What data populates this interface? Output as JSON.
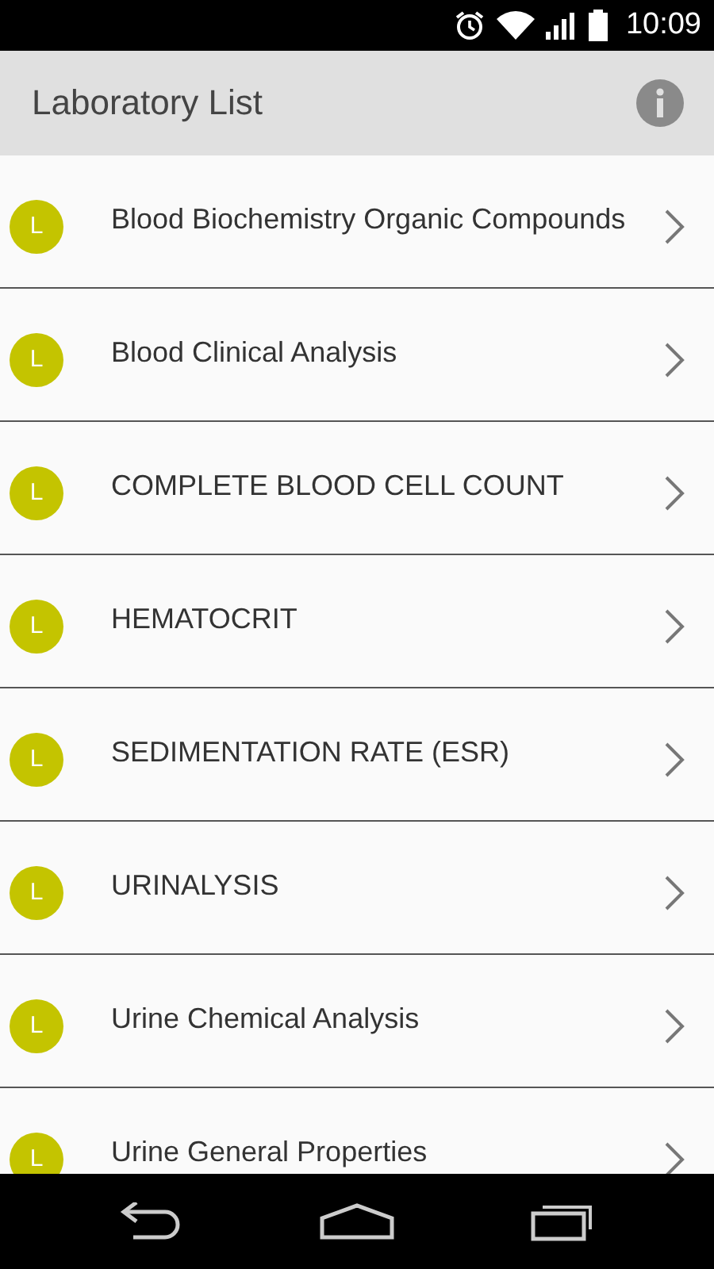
{
  "status_bar": {
    "time": "10:09"
  },
  "header": {
    "title": "Laboratory List"
  },
  "items": [
    {
      "badge": "L",
      "label": "Blood Biochemistry Organic Compounds"
    },
    {
      "badge": "L",
      "label": "Blood Clinical Analysis"
    },
    {
      "badge": "L",
      "label": "COMPLETE BLOOD CELL COUNT"
    },
    {
      "badge": "L",
      "label": "HEMATOCRIT"
    },
    {
      "badge": "L",
      "label": "SEDIMENTATION RATE (ESR)"
    },
    {
      "badge": "L",
      "label": "URINALYSIS"
    },
    {
      "badge": "L",
      "label": "Urine Chemical Analysis"
    },
    {
      "badge": "L",
      "label": "Urine General Properties"
    }
  ]
}
